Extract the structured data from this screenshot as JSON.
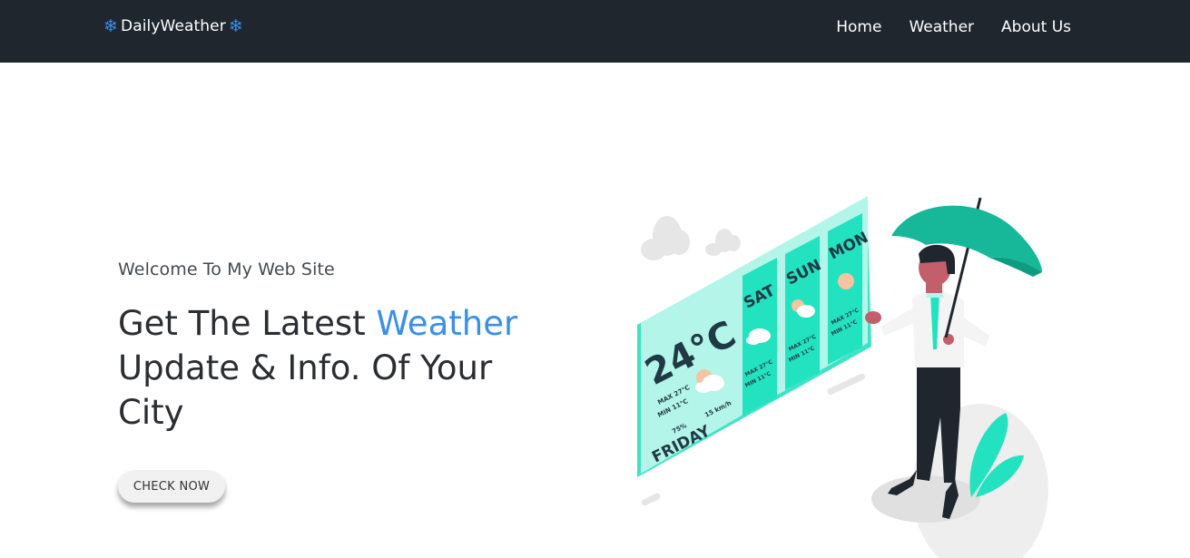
{
  "navbar": {
    "brand_icon_left": "❄",
    "brand": "DailyWeather",
    "brand_icon_right": "❄",
    "links": [
      "Home",
      "Weather",
      "About Us"
    ]
  },
  "hero": {
    "welcome": "Welcome To My Web Site",
    "headline_part1": "Get The Latest ",
    "headline_accent": "Weather",
    "headline_part2": " Update & Info. Of Your City",
    "cta_label": "CHECK NOW"
  },
  "illustration": {
    "temperature": "24°C",
    "today_max": "MAX  27°C",
    "today_min": "MIN  11°C",
    "humidity": "75%",
    "wind": "15 km/h",
    "day": "FRIDAY",
    "forecast": [
      {
        "day": "SAT",
        "max": "MAX 27°C",
        "min": "MIN 11°C"
      },
      {
        "day": "SUN",
        "max": "MAX 27°C",
        "min": "MIN 11°C"
      },
      {
        "day": "MON",
        "max": "MAX 27°C",
        "min": "MIN 11°C"
      }
    ]
  },
  "colors": {
    "navbar_bg": "#1f262e",
    "accent": "#3a8fe8",
    "panel": "#b3f5e8",
    "panel_strong": "#23e2c0",
    "umbrella": "#16b899"
  }
}
